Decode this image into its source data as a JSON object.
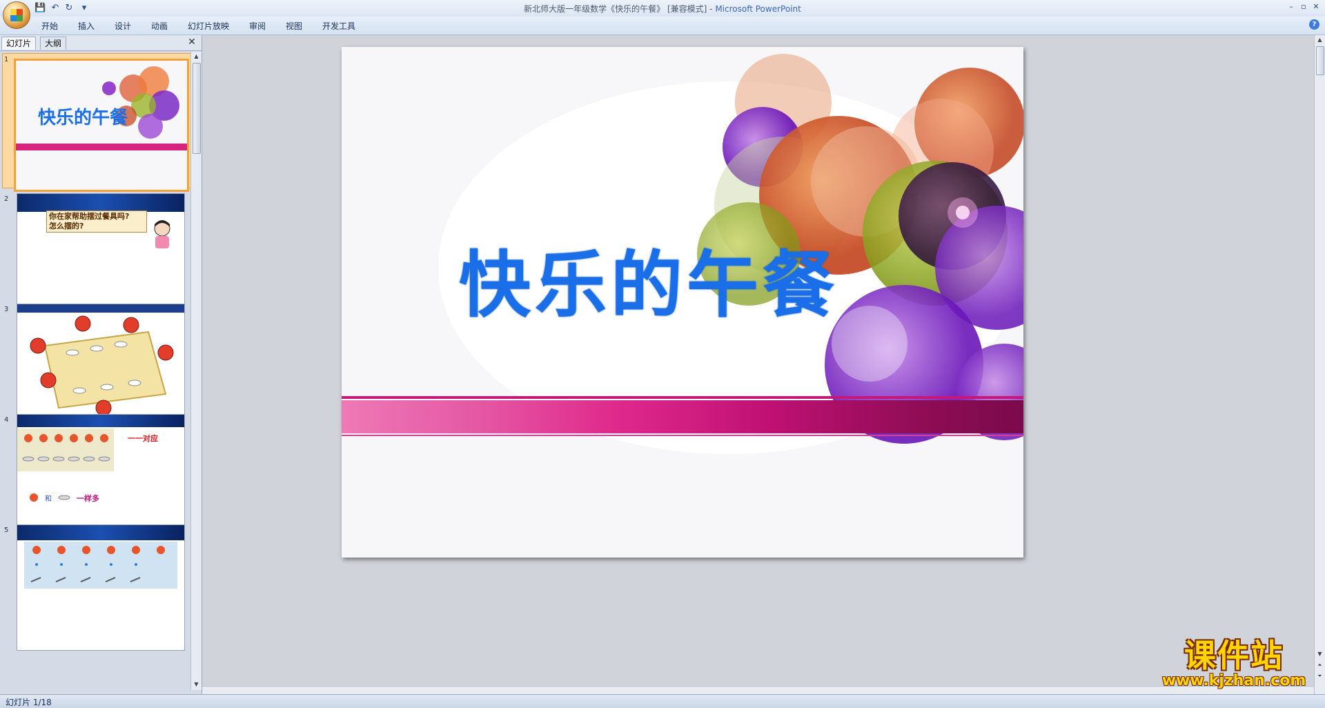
{
  "window": {
    "title_doc": "新北师大版一年级数学《快乐的午餐》 [兼容模式] - ",
    "title_app": "Microsoft PowerPoint",
    "minimize_icon": "minimize-icon",
    "maximize_icon": "maximize-icon",
    "close_icon": "close-icon"
  },
  "quick_access": [
    {
      "icon": "save-icon",
      "glyph": "💾"
    },
    {
      "icon": "undo-icon",
      "glyph": "↶"
    },
    {
      "icon": "redo-icon",
      "glyph": "↻"
    },
    {
      "icon": "customize-icon",
      "glyph": "▾"
    }
  ],
  "ribbon": {
    "tabs": [
      "开始",
      "插入",
      "设计",
      "动画",
      "幻灯片放映",
      "审阅",
      "视图",
      "开发工具"
    ],
    "help_glyph": "?"
  },
  "left_pane": {
    "tabs": [
      "幻灯片",
      "大纲"
    ],
    "close_glyph": "✕",
    "slides": [
      {
        "num": "1",
        "title": "快乐的午餐",
        "selected": true
      },
      {
        "num": "2",
        "text_line1": "你在家帮助摆过餐具吗?",
        "text_line2": "怎么摆的?"
      },
      {
        "num": "3"
      },
      {
        "num": "4",
        "label_a": "一一对应",
        "label_b": "和",
        "label_c": "一样多"
      },
      {
        "num": "5"
      }
    ]
  },
  "slide": {
    "title": "快乐的午餐",
    "title_color": "#1a6fe8",
    "band_color": "#c11174"
  },
  "status": {
    "slide_counter": "幻灯片 1/18"
  },
  "watermark": {
    "cn": "课件站",
    "url": "www.kjzhan.com"
  }
}
